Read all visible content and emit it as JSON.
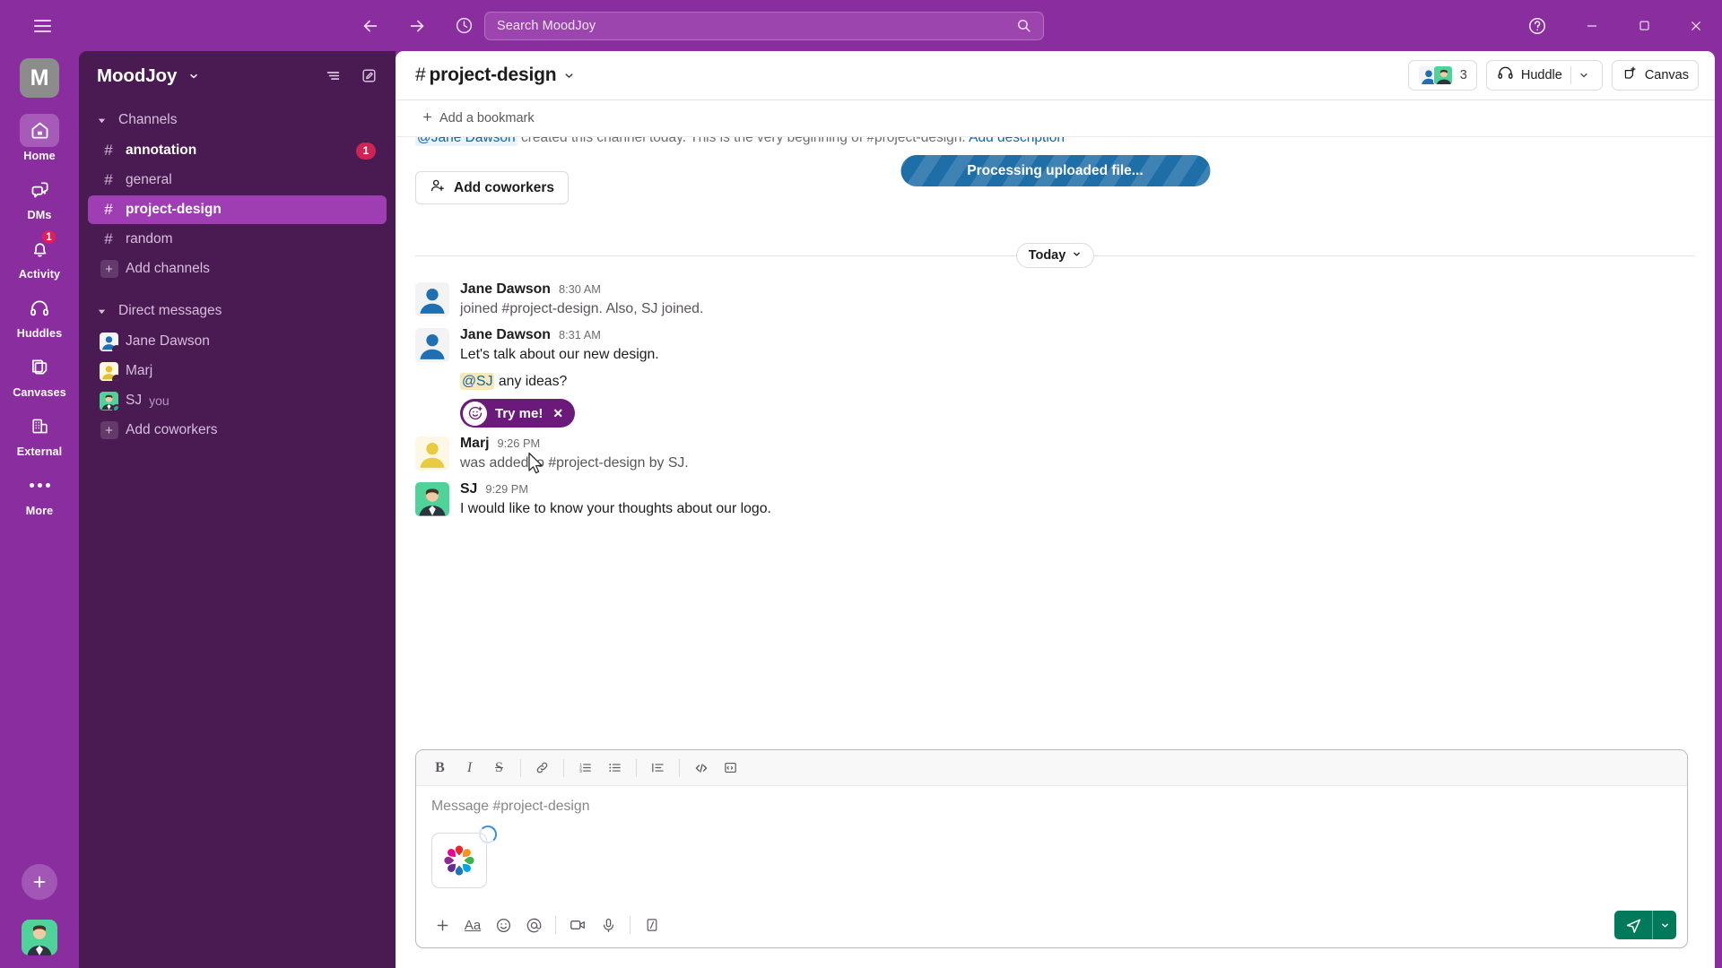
{
  "topbar": {
    "hamburger": "menu-icon",
    "back": "back-arrow-icon",
    "forward": "forward-arrow-icon",
    "history": "clock-icon",
    "search_placeholder": "Search MoodJoy",
    "help": "question-mark-icon",
    "minimize": "minimize-icon",
    "maximize": "maximize-icon",
    "close": "close-icon"
  },
  "rail": {
    "workspace_initial": "M",
    "items": [
      {
        "label": "Home",
        "icon": "home-icon",
        "active": true,
        "badge": ""
      },
      {
        "label": "DMs",
        "icon": "dm-icon",
        "active": false,
        "badge": ""
      },
      {
        "label": "Activity",
        "icon": "bell-icon",
        "active": false,
        "badge": "1"
      },
      {
        "label": "Huddles",
        "icon": "headphones-icon",
        "active": false,
        "badge": ""
      },
      {
        "label": "Canvases",
        "icon": "canvas-icon",
        "active": false,
        "badge": ""
      },
      {
        "label": "External",
        "icon": "building-icon",
        "active": false,
        "badge": ""
      },
      {
        "label": "More",
        "icon": "ellipsis-icon",
        "active": false,
        "badge": ""
      }
    ],
    "add_label": "plus-icon",
    "avatar_label": "user-avatar"
  },
  "sidebar": {
    "workspace_name": "MoodJoy",
    "filter_icon": "filter-icon",
    "compose_icon": "compose-icon",
    "sections": [
      {
        "label": "Channels",
        "rows": [
          {
            "type": "channel",
            "name": "annotation",
            "unread": true,
            "count": "1",
            "selected": false
          },
          {
            "type": "channel",
            "name": "general",
            "unread": false,
            "count": "",
            "selected": false
          },
          {
            "type": "channel",
            "name": "project-design",
            "unread": false,
            "count": "",
            "selected": true
          },
          {
            "type": "channel",
            "name": "random",
            "unread": false,
            "count": "",
            "selected": false
          },
          {
            "type": "add",
            "name": "Add channels",
            "unread": false,
            "count": "",
            "selected": false
          }
        ]
      },
      {
        "label": "Direct messages",
        "rows": [
          {
            "type": "dm",
            "name": "Jane Dawson",
            "presence": "away",
            "avatar": "blue",
            "suffix": ""
          },
          {
            "type": "dm",
            "name": "Marj",
            "presence": "away",
            "avatar": "yellow",
            "suffix": ""
          },
          {
            "type": "dm",
            "name": "SJ",
            "presence": "online",
            "avatar": "green",
            "suffix": "you"
          },
          {
            "type": "add",
            "name": "Add coworkers",
            "presence": "",
            "avatar": "",
            "suffix": ""
          }
        ]
      }
    ]
  },
  "channel": {
    "hash": "#",
    "name": "project-design",
    "members_count": "3",
    "huddle_label": "Huddle",
    "canvas_label": "Canvas",
    "bookmark_label": "Add a bookmark"
  },
  "messages_pane": {
    "intro_prefix": "@Jane Dawson",
    "intro_text": " created this channel today. This is the very beginning of ",
    "intro_channel": "#project-design.",
    "intro_link": " Add description",
    "add_coworkers_label": "Add coworkers",
    "processing_banner": "Processing uploaded file...",
    "day_divider": "Today",
    "messages": [
      {
        "author": "Jane Dawson",
        "time": "8:30 AM",
        "text": "joined #project-design. Also, SJ joined.",
        "system": true,
        "avatar": "blue",
        "sub_mention": "",
        "sub_text": "",
        "pill": ""
      },
      {
        "author": "Jane Dawson",
        "time": "8:31 AM",
        "text": "Let's talk about our new design.",
        "system": false,
        "avatar": "blue",
        "sub_mention": "@SJ",
        "sub_text": " any ideas?",
        "pill": "Try me!"
      },
      {
        "author": "Marj",
        "time": "9:26 PM",
        "text": "was added to #project-design by SJ.",
        "system": true,
        "avatar": "yellow",
        "sub_mention": "",
        "sub_text": "",
        "pill": ""
      },
      {
        "author": "SJ",
        "time": "9:29 PM",
        "text": "I would like to know your thoughts about our logo.",
        "system": false,
        "avatar": "green",
        "sub_mention": "",
        "sub_text": "",
        "pill": ""
      }
    ]
  },
  "composer": {
    "placeholder": "Message #project-design",
    "format_buttons": [
      {
        "name": "bold",
        "glyph": "B"
      },
      {
        "name": "italic",
        "glyph": "I"
      },
      {
        "name": "strikethrough",
        "glyph": "S"
      },
      {
        "name": "link",
        "glyph": "link-icon"
      },
      {
        "name": "ordered-list",
        "glyph": "ordered-list-icon"
      },
      {
        "name": "bulleted-list",
        "glyph": "bulleted-list-icon"
      },
      {
        "name": "blockquote",
        "glyph": "blockquote-icon"
      },
      {
        "name": "code",
        "glyph": "code-icon"
      },
      {
        "name": "code-block",
        "glyph": "code-block-icon"
      }
    ],
    "action_buttons": [
      {
        "name": "attach",
        "glyph": "plus-icon"
      },
      {
        "name": "formatting",
        "glyph": "Aa"
      },
      {
        "name": "emoji",
        "glyph": "emoji-icon"
      },
      {
        "name": "mention",
        "glyph": "at-icon"
      },
      {
        "name": "video",
        "glyph": "video-icon"
      },
      {
        "name": "audio",
        "glyph": "microphone-icon"
      },
      {
        "name": "shortcuts",
        "glyph": "slash-icon"
      }
    ],
    "attachment_name": "uploading-logo-thumbnail",
    "send_label": "send-icon",
    "send_caret": "chevron-down-icon"
  },
  "colors": {
    "brand_purple": "#8a2d9e",
    "sidebar_purple": "#4a1a52",
    "selected_purple": "#9e3eb2",
    "badge_red": "#cd2553",
    "send_green": "#007a5a",
    "banner_blue": "#1e6fa8",
    "mention_yellow": "#f8e9b9"
  }
}
